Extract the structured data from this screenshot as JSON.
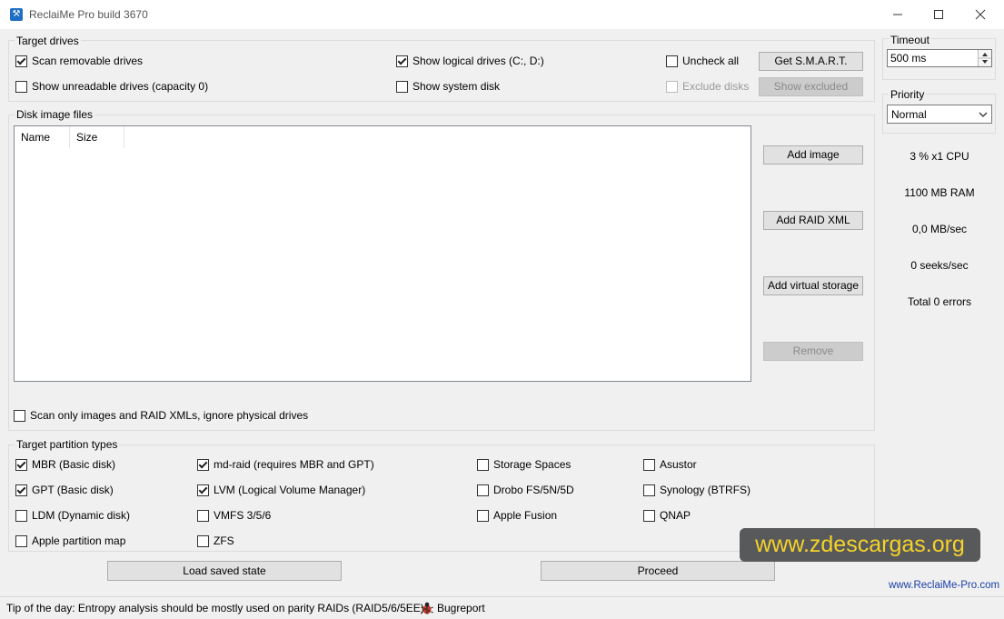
{
  "window": {
    "title": "ReclaiMe Pro build 3670",
    "app_icon_glyph": "⚒"
  },
  "target_drives": {
    "title": "Target drives",
    "scan_removable": {
      "label": "Scan removable drives",
      "checked": true
    },
    "show_logical": {
      "label": "Show logical drives (C:, D:)",
      "checked": true
    },
    "uncheck_all": {
      "label": "Uncheck all",
      "checked": false
    },
    "show_unreadable": {
      "label": "Show unreadable drives (capacity 0)",
      "checked": false
    },
    "show_system": {
      "label": "Show system disk",
      "checked": false
    },
    "exclude_disks": {
      "label": "Exclude disks",
      "checked": false
    },
    "get_smart_label": "Get S.M.A.R.T.",
    "show_excluded_label": "Show excluded"
  },
  "disk_images": {
    "title": "Disk image files",
    "columns": [
      "Name",
      "Size"
    ],
    "add_image_label": "Add image",
    "add_raid_xml_label": "Add RAID XML",
    "add_virtual_storage_label": "Add virtual storage",
    "remove_label": "Remove",
    "scan_only": {
      "label": "Scan only images and RAID XMLs, ignore physical drives",
      "checked": false
    }
  },
  "partition_types": {
    "title": "Target partition types",
    "items": [
      {
        "label": "MBR (Basic disk)",
        "checked": true
      },
      {
        "label": "GPT (Basic disk)",
        "checked": true
      },
      {
        "label": "LDM (Dynamic disk)",
        "checked": false
      },
      {
        "label": "Apple partition map",
        "checked": false
      },
      {
        "label": "md-raid (requires MBR and GPT)",
        "checked": true
      },
      {
        "label": "LVM (Logical Volume Manager)",
        "checked": true
      },
      {
        "label": "VMFS 3/5/6",
        "checked": false
      },
      {
        "label": "ZFS",
        "checked": false
      },
      {
        "label": "Storage Spaces",
        "checked": false
      },
      {
        "label": "Drobo FS/5N/5D",
        "checked": false
      },
      {
        "label": "Apple Fusion",
        "checked": false
      },
      {
        "label": "Asustor",
        "checked": false
      },
      {
        "label": "Synology (BTRFS)",
        "checked": false
      },
      {
        "label": "QNAP",
        "checked": false
      }
    ]
  },
  "actions": {
    "load_saved_state_label": "Load saved state",
    "proceed_label": "Proceed"
  },
  "side_panel": {
    "timeout_title": "Timeout",
    "timeout_value": "500 ms",
    "priority_title": "Priority",
    "priority_value": "Normal",
    "stats": {
      "cpu": "3 % x1 CPU",
      "ram": "1100 MB RAM",
      "speed": "0,0 MB/sec",
      "seeks": "0 seeks/sec",
      "errors": "Total 0 errors"
    },
    "website_link": "www.ReclaiMe-Pro.com"
  },
  "status_bar": {
    "tip": "Tip of the day: Entropy analysis should be mostly used on parity RAIDs (RAID5/6/5EE).",
    "bugreport_label": "Bugreport"
  },
  "watermark": "www.zdescargas.org",
  "colors": {
    "watermark_bg": "#58595b",
    "watermark_text": "#f5d22a",
    "link": "#1a3fa6"
  }
}
